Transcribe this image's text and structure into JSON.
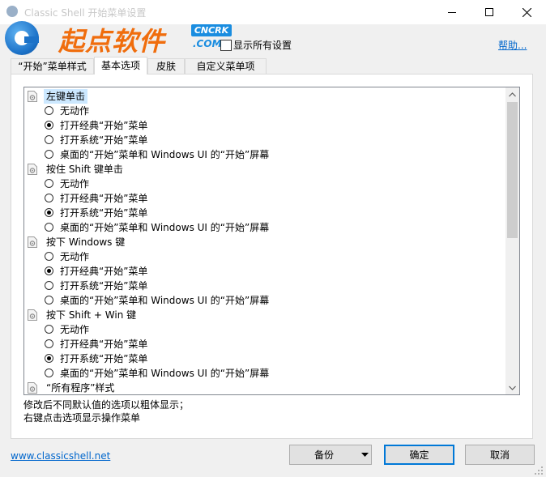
{
  "window": {
    "title": "Classic Shell 开始菜单设置",
    "minimize_icon": "minimize-icon",
    "maximize_icon": "maximize-icon",
    "close_icon": "close-icon"
  },
  "watermark": {
    "cn": "起点软件",
    "badge": "CNCRK",
    "domain": ".COM"
  },
  "header": {
    "show_all_label": "显示所有设置",
    "help_label": "帮助..."
  },
  "tabs": [
    {
      "label": "“开始”菜单样式",
      "active": false
    },
    {
      "label": "基本选项",
      "active": true
    },
    {
      "label": "皮肤",
      "active": false
    },
    {
      "label": "自定义菜单项",
      "active": false
    }
  ],
  "groups": [
    {
      "label": "左键单击",
      "selected": true,
      "options": [
        {
          "label": "无动作",
          "checked": false
        },
        {
          "label": "打开经典“开始”菜单",
          "checked": true
        },
        {
          "label": "打开系统“开始”菜单",
          "checked": false
        },
        {
          "label": "桌面的“开始”菜单和 Windows UI 的“开始”屏幕",
          "checked": false
        }
      ]
    },
    {
      "label": "按住 Shift 键单击",
      "selected": false,
      "options": [
        {
          "label": "无动作",
          "checked": false
        },
        {
          "label": "打开经典“开始”菜单",
          "checked": false
        },
        {
          "label": "打开系统“开始”菜单",
          "checked": true
        },
        {
          "label": "桌面的“开始”菜单和 Windows UI 的“开始”屏幕",
          "checked": false
        }
      ]
    },
    {
      "label": "按下 Windows 键",
      "selected": false,
      "options": [
        {
          "label": "无动作",
          "checked": false
        },
        {
          "label": "打开经典“开始”菜单",
          "checked": true
        },
        {
          "label": "打开系统“开始”菜单",
          "checked": false
        },
        {
          "label": "桌面的“开始”菜单和 Windows UI 的“开始”屏幕",
          "checked": false
        }
      ]
    },
    {
      "label": "按下 Shift + Win 键",
      "selected": false,
      "options": [
        {
          "label": "无动作",
          "checked": false
        },
        {
          "label": "打开经典“开始”菜单",
          "checked": false
        },
        {
          "label": "打开系统“开始”菜单",
          "checked": true
        },
        {
          "label": "桌面的“开始”菜单和 Windows UI 的“开始”屏幕",
          "checked": false
        }
      ]
    },
    {
      "label": "“所有程序”样式",
      "selected": false,
      "options": []
    }
  ],
  "hint": {
    "line1": "修改后不同默认值的选项以粗体显示；",
    "line2": "右键点击选项显示操作菜单"
  },
  "footer": {
    "site_link": "www.classicshell.net",
    "backup_label": "备份",
    "ok_label": "确定",
    "cancel_label": "取消"
  },
  "colors": {
    "accent": "#0078d7",
    "link": "#0066cc",
    "selection": "#cce8ff",
    "watermark_orange": "#f06d0d",
    "watermark_blue": "#1a8de0"
  }
}
